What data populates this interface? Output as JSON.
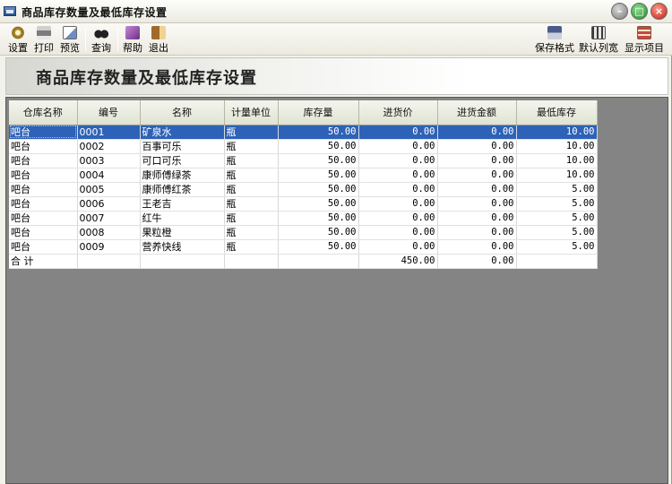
{
  "window": {
    "title": "商品库存数量及最低库存设置"
  },
  "toolbar": {
    "left": [
      {
        "id": "settings",
        "label": "设置",
        "icon": "gear-icon"
      },
      {
        "id": "print",
        "label": "打印",
        "icon": "printer-icon"
      },
      {
        "id": "preview",
        "label": "预览",
        "icon": "preview-icon"
      },
      {
        "id": "query",
        "label": "查询",
        "icon": "binoculars-icon"
      },
      {
        "id": "help",
        "label": "帮助",
        "icon": "help-book-icon"
      },
      {
        "id": "exit",
        "label": "退出",
        "icon": "exit-door-icon"
      }
    ],
    "right": [
      {
        "id": "save-format",
        "label": "保存格式",
        "icon": "save-format-icon"
      },
      {
        "id": "default-width",
        "label": "默认列宽",
        "icon": "column-width-icon"
      },
      {
        "id": "show-items",
        "label": "显示项目",
        "icon": "show-columns-icon"
      }
    ]
  },
  "heading": "商品库存数量及最低库存设置",
  "grid": {
    "columns": [
      "仓库名称",
      "编号",
      "名称",
      "计量单位",
      "库存量",
      "进货价",
      "进货金额",
      "最低库存"
    ],
    "rows": [
      [
        "吧台",
        "0001",
        "矿泉水",
        "瓶",
        "50.00",
        "0.00",
        "0.00",
        "10.00"
      ],
      [
        "吧台",
        "0002",
        "百事可乐",
        "瓶",
        "50.00",
        "0.00",
        "0.00",
        "10.00"
      ],
      [
        "吧台",
        "0003",
        "可口可乐",
        "瓶",
        "50.00",
        "0.00",
        "0.00",
        "10.00"
      ],
      [
        "吧台",
        "0004",
        "康师傅绿茶",
        "瓶",
        "50.00",
        "0.00",
        "0.00",
        "10.00"
      ],
      [
        "吧台",
        "0005",
        "康师傅红茶",
        "瓶",
        "50.00",
        "0.00",
        "0.00",
        "5.00"
      ],
      [
        "吧台",
        "0006",
        "王老吉",
        "瓶",
        "50.00",
        "0.00",
        "0.00",
        "5.00"
      ],
      [
        "吧台",
        "0007",
        "红牛",
        "瓶",
        "50.00",
        "0.00",
        "0.00",
        "5.00"
      ],
      [
        "吧台",
        "0008",
        "果粒橙",
        "瓶",
        "50.00",
        "0.00",
        "0.00",
        "5.00"
      ],
      [
        "吧台",
        "0009",
        "营养快线",
        "瓶",
        "50.00",
        "0.00",
        "0.00",
        "5.00"
      ]
    ],
    "selected_row_index": 0,
    "total": {
      "label": "合 计",
      "stock_total": "450.00",
      "amount_total": "0.00"
    }
  }
}
